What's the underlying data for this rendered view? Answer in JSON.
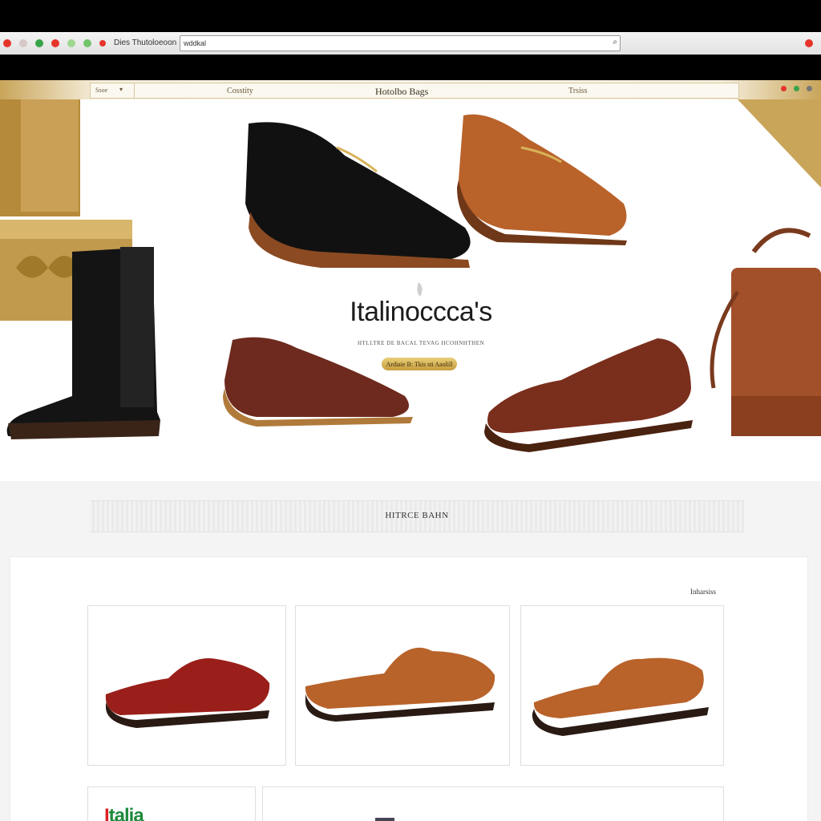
{
  "browser": {
    "tab_title": "Dies Thutoloeoon",
    "url": "wddkal",
    "search_icon": "magnifier-icon"
  },
  "nav": {
    "left": "Ssoe",
    "item_left": "Cosstity",
    "item_center": "Hotolbo Bags",
    "item_right": "Trsiss"
  },
  "hero": {
    "brand": "Italinoccca's",
    "tagline": "HTLLTRE DE BACAL TEVAG HCOHNHTHEN",
    "cta_label": "Ardiaie B: Tkis sti Aaolill"
  },
  "section": {
    "title": "HITRCE BAHN"
  },
  "products": {
    "label": "Inharsiss",
    "cards": [
      {
        "name": "red-loafer",
        "color": "#9a1f1a"
      },
      {
        "name": "tan-loafer",
        "color": "#b8632a"
      },
      {
        "name": "caramel-loafer",
        "color": "#b9622a"
      }
    ]
  },
  "colors": {
    "gold": "#c9a55a",
    "brand_text": "#1c1c1c",
    "accent_green": "#1e8a3c",
    "accent_red": "#d22222"
  }
}
